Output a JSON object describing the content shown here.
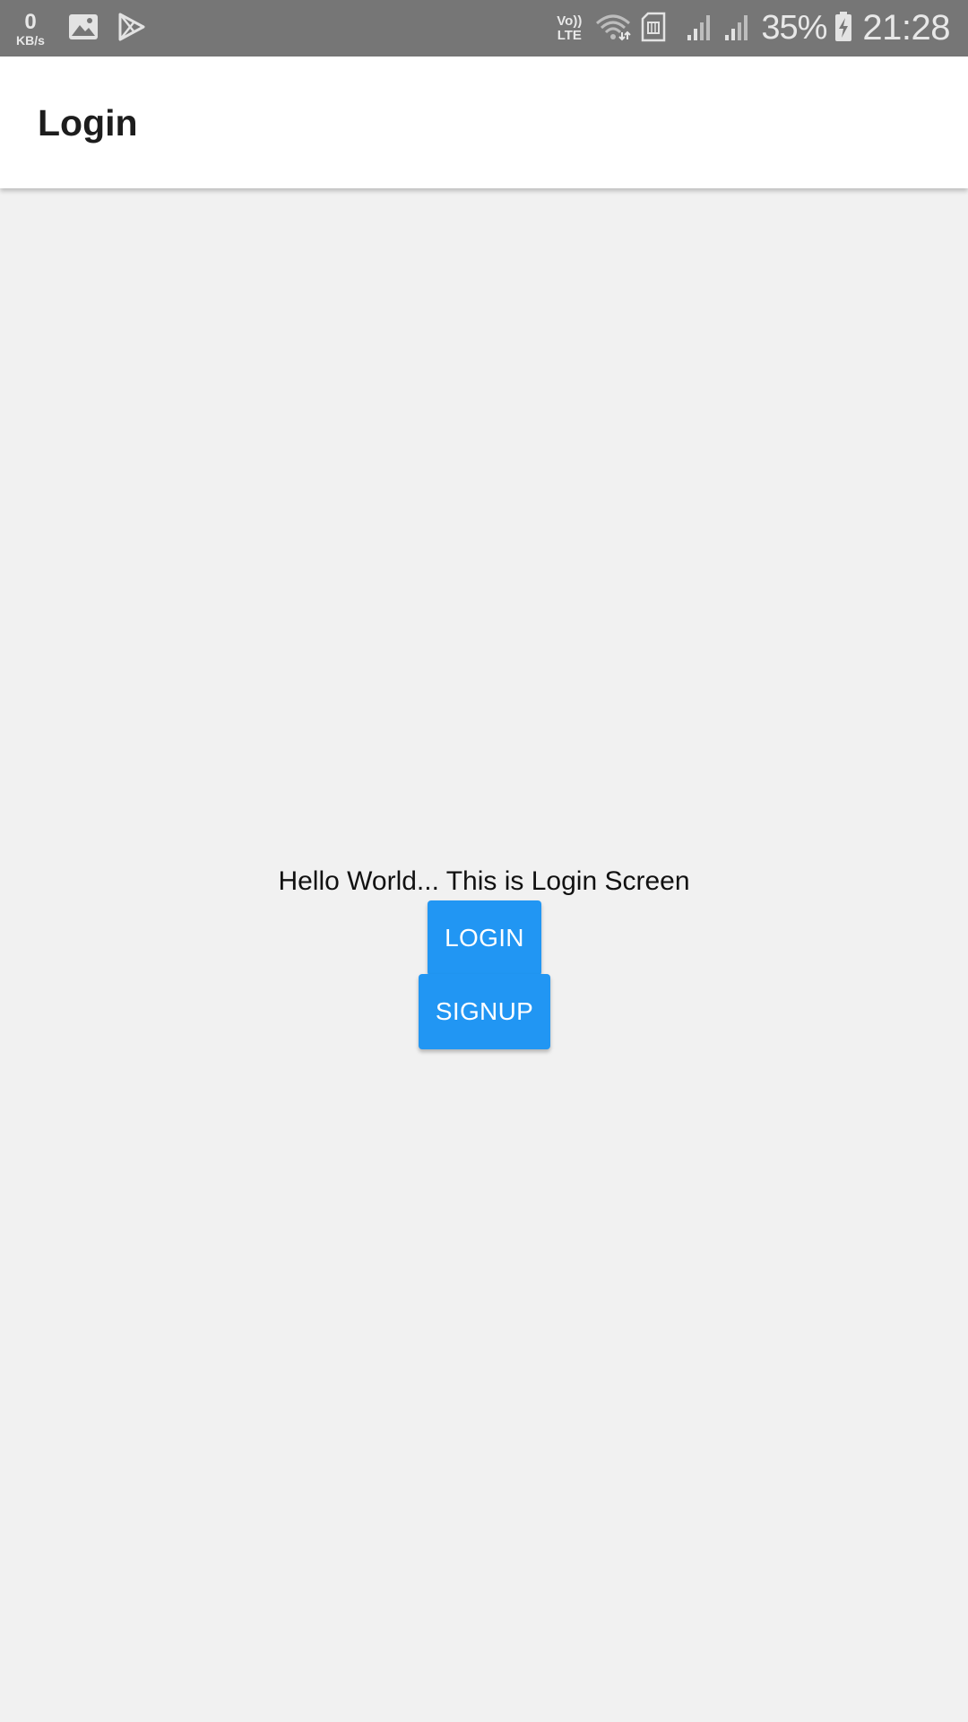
{
  "status_bar": {
    "net_speed_value": "0",
    "net_speed_unit": "KB/s",
    "volte_line1": "Vo))",
    "volte_line2": "LTE",
    "battery_percent": "35%",
    "time": "21:28",
    "icons": [
      "gallery-icon",
      "play-store-icon",
      "wifi-icon",
      "sim-icon",
      "signal-1-icon",
      "signal-2-icon",
      "battery-charging-icon"
    ]
  },
  "app_bar": {
    "title": "Login"
  },
  "main": {
    "message": "Hello World... This is Login Screen",
    "login_label": "LOGIN",
    "signup_label": "SIGNUP"
  },
  "colors": {
    "status_bar_bg": "#767676",
    "app_bar_bg": "#ffffff",
    "content_bg": "#f1f1f1",
    "button_bg": "#2196f3",
    "button_text": "#ffffff"
  }
}
